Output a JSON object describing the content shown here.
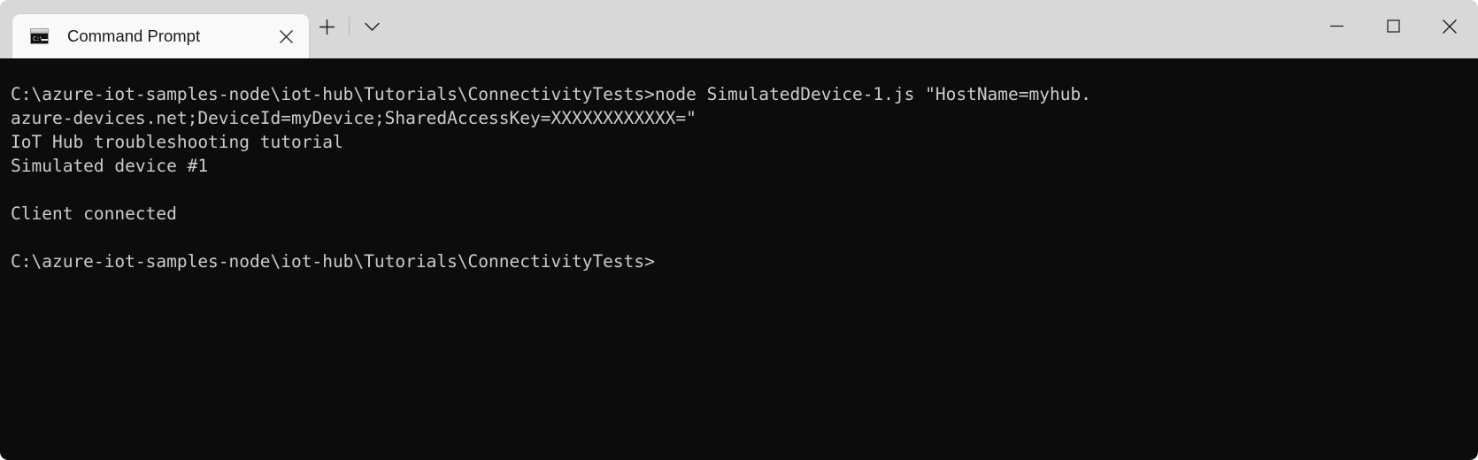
{
  "window": {
    "app_name": "Command Prompt",
    "titlebar_bg": "#d8d8d8",
    "console_bg": "#0c0c0c",
    "console_fg": "#cccccc"
  },
  "tab": {
    "title": "Command Prompt",
    "icon": "command-prompt-icon",
    "icon_prompt_text": "C:\\",
    "close_icon": "close-icon"
  },
  "tab_actions": {
    "new_tab_label": "+",
    "new_tab_icon": "plus-icon",
    "dropdown_icon": "chevron-down-icon"
  },
  "window_controls": {
    "minimize_icon": "minimize-icon",
    "maximize_icon": "maximize-icon",
    "close_icon": "close-icon"
  },
  "console": {
    "lines": [
      "C:\\azure-iot-samples-node\\iot-hub\\Tutorials\\ConnectivityTests>node SimulatedDevice-1.js \"HostName=myhub.",
      "azure-devices.net;DeviceId=myDevice;SharedAccessKey=XXXXXXXXXXXX=\"",
      "IoT Hub troubleshooting tutorial",
      "Simulated device #1",
      "",
      "Client connected",
      "",
      "C:\\azure-iot-samples-node\\iot-hub\\Tutorials\\ConnectivityTests>"
    ]
  }
}
